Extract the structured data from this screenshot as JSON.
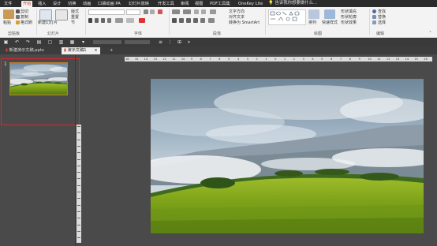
{
  "menubar": {
    "tabs": [
      "文件",
      "开始",
      "插入",
      "设计",
      "切换",
      "动画",
      "口袋动画 PA",
      "幻灯片放映",
      "开发工具",
      "审阅",
      "视图",
      "PDF工具集",
      "OneKey Lite"
    ],
    "active": "开始",
    "tellme": "告诉我你想要做什么..."
  },
  "ribbon": {
    "clipboard": {
      "paste": "粘贴",
      "cut": "剪切",
      "copy": "复制",
      "format_painter": "格式刷",
      "label": "剪贴板"
    },
    "slides": {
      "new_slide": "新建幻灯片",
      "layout": "版式",
      "reset": "重置",
      "section": "节",
      "label": "幻灯片"
    },
    "font": {
      "label": "字体"
    },
    "paragraph": {
      "text_direction": "文字方向",
      "align_text": "对齐文本",
      "smartart": "转换为 SmartArt",
      "label": "段落"
    },
    "drawing": {
      "label": "绘图",
      "arrange": "排列",
      "quick_styles": "快速样式",
      "shape_fill": "形状填充",
      "shape_outline": "形状轮廓",
      "shape_effects": "形状效果"
    },
    "editing": {
      "find": "查找",
      "replace": "替换",
      "select": "选择",
      "label": "编辑"
    }
  },
  "doctabs": [
    {
      "label": "新建演示文稿.pptx",
      "active": false
    },
    {
      "label": "演示文稿1",
      "active": true
    }
  ],
  "thumbs": {
    "slide_number": "1"
  },
  "hruler_numbers": [
    "16",
    "15",
    "14",
    "13",
    "12",
    "11",
    "10",
    "9",
    "8",
    "7",
    "6",
    "5",
    "4",
    "3",
    "2",
    "1",
    "0",
    "1",
    "2",
    "3",
    "4",
    "5",
    "6",
    "7",
    "8",
    "9",
    "10",
    "11",
    "12",
    "13",
    "14",
    "15",
    "16"
  ],
  "colors": {
    "accent": "#b7472a",
    "selection": "#e0262b"
  }
}
